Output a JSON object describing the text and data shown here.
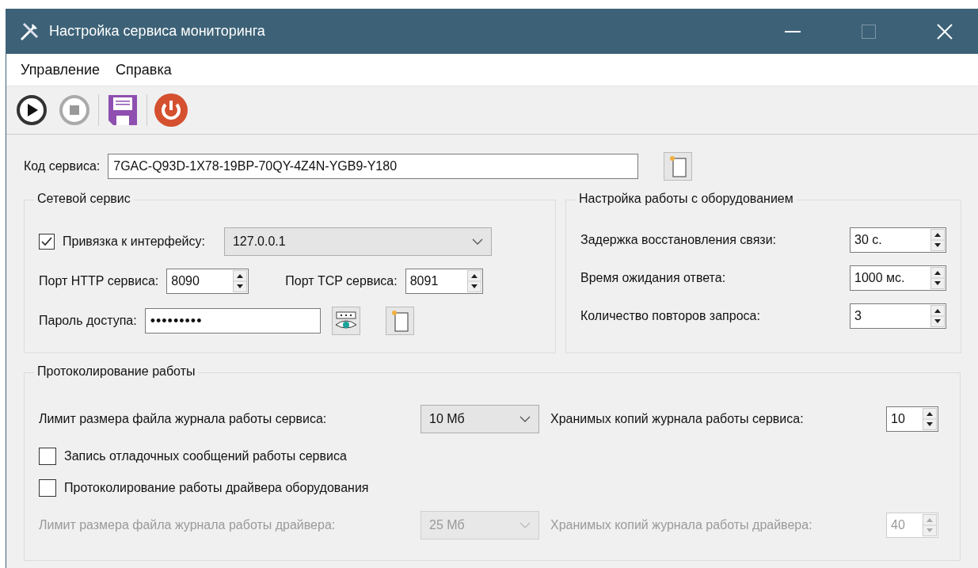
{
  "window": {
    "title": "Настройка сервиса мониторинга"
  },
  "menu": [
    {
      "label": "Управление"
    },
    {
      "label": "Справка"
    }
  ],
  "toolbar": [
    {
      "kind": "start",
      "disabled": false
    },
    {
      "kind": "stop",
      "disabled": true
    },
    {
      "kind": "save",
      "disabled": false
    },
    {
      "kind": "power",
      "disabled": false
    }
  ],
  "service_code": {
    "label": "Код сервиса:",
    "value": "7GAC-Q93D-1X78-19BP-70QY-4Z4N-YGB9-Y180"
  },
  "network": {
    "title": "Сетевой сервис",
    "bind": {
      "label": "Привязка к интерфейсу:",
      "checked": true,
      "value": "127.0.0.1"
    },
    "http_port": {
      "label": "Порт HTTP сервиса:",
      "value": "8090"
    },
    "tcp_port": {
      "label": "Порт TCP сервиса:",
      "value": "8091"
    },
    "password": {
      "label": "Пароль доступа:",
      "value": "•••••••••"
    }
  },
  "equipment": {
    "title": "Настройка работы с оборудованием",
    "rows": [
      {
        "label": "Задержка восстановления связи:",
        "value": "30 с."
      },
      {
        "label": "Время ожидания ответа:",
        "value": "1000 мс."
      },
      {
        "label": "Количество повторов запроса:",
        "value": "3"
      }
    ]
  },
  "logging": {
    "title": "Протоколирование работы",
    "rows": [
      {
        "kind": "limits",
        "disabled": false,
        "size_label": "Лимит размера файла журнала работы сервиса:",
        "size_value": "10 Мб",
        "copies_label": "Хранимых копий журнала работы сервиса:",
        "copies_value": "10"
      },
      {
        "kind": "checkbox",
        "label": "Запись отладочных сообщений работы сервиса",
        "checked": false
      },
      {
        "kind": "checkbox",
        "label": "Протоколирование работы драйвера оборудования",
        "checked": false
      },
      {
        "kind": "limits",
        "disabled": true,
        "size_label": "Лимит размера файла журнала работы драйвера:",
        "size_value": "25 Мб",
        "copies_label": "Хранимых копий журнала работы драйвера:",
        "copies_value": "40"
      }
    ]
  }
}
